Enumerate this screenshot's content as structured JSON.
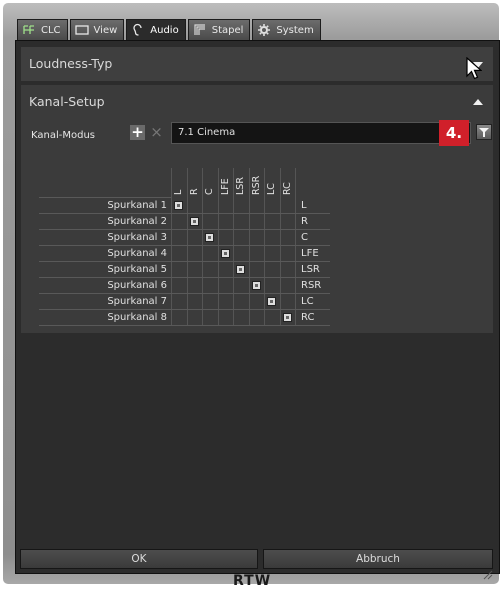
{
  "tabs": [
    {
      "label": "CLC",
      "icon": "clc-icon"
    },
    {
      "label": "View",
      "icon": "view-icon"
    },
    {
      "label": "Audio",
      "icon": "ear-icon"
    },
    {
      "label": "Stapel",
      "icon": "stack-icon"
    },
    {
      "label": "System",
      "icon": "gear-icon"
    }
  ],
  "active_tab": "Audio",
  "sections": {
    "loudness": {
      "title": "Loudness-Typ",
      "state": "collapsed"
    },
    "kanal": {
      "title": "Kanal-Setup",
      "state": "expanded"
    }
  },
  "kanal": {
    "mode_label": "Kanal-Modus",
    "mode_value": "7.1 Cinema",
    "step_badge": "4.",
    "columns": [
      "L",
      "R",
      "C",
      "LFE",
      "LSR",
      "RSR",
      "LC",
      "RC"
    ],
    "rows": [
      {
        "label": "Spurkanal 1",
        "out": "L"
      },
      {
        "label": "Spurkanal 2",
        "out": "R"
      },
      {
        "label": "Spurkanal 3",
        "out": "C"
      },
      {
        "label": "Spurkanal 4",
        "out": "LFE"
      },
      {
        "label": "Spurkanal 5",
        "out": "LSR"
      },
      {
        "label": "Spurkanal 6",
        "out": "RSR"
      },
      {
        "label": "Spurkanal 7",
        "out": "LC"
      },
      {
        "label": "Spurkanal 8",
        "out": "RC"
      }
    ],
    "assignments": [
      0,
      1,
      2,
      3,
      4,
      5,
      6,
      7
    ]
  },
  "buttons": {
    "ok": "OK",
    "cancel": "Abbruch"
  },
  "brand": "RTW"
}
